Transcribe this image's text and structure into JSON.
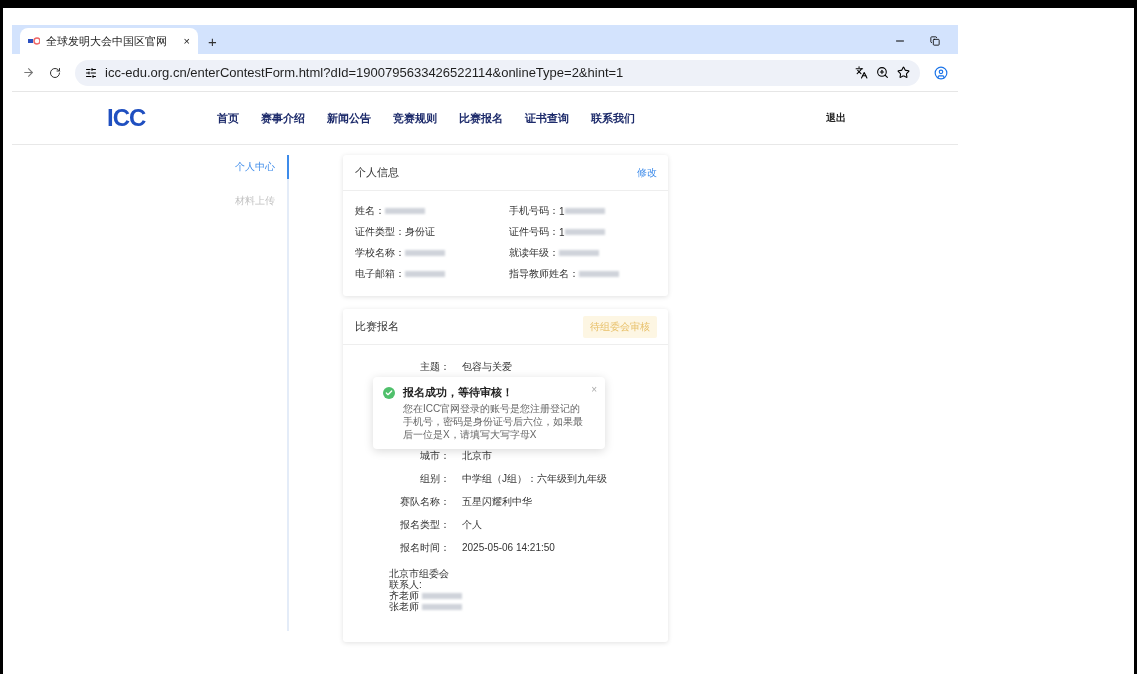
{
  "browser": {
    "tab_title": "全球发明大会中国区官网",
    "tab_close": "×",
    "new_tab": "+",
    "url": "icc-edu.org.cn/enterContestForm.html?dId=1900795633426522114&onlineType=2&hint=1"
  },
  "header": {
    "logo_big": "ICC",
    "nav": [
      {
        "label": "首页"
      },
      {
        "label": "赛事介绍"
      },
      {
        "label": "新闻公告"
      },
      {
        "label": "竞赛规则"
      },
      {
        "label": "比赛报名"
      },
      {
        "label": "证书查询"
      },
      {
        "label": "联系我们"
      }
    ],
    "logout": "退出"
  },
  "sidebar": {
    "items": [
      {
        "label": "个人中心",
        "selected": true
      },
      {
        "label": "材料上传",
        "selected": false
      }
    ]
  },
  "profile": {
    "title": "个人信息",
    "edit": "修改",
    "fields": [
      {
        "label": "姓名：",
        "blurred": true
      },
      {
        "label": "手机号码：",
        "value": "1",
        "blurred": true
      },
      {
        "label": "证件类型：",
        "value": "身份证",
        "blurred": false
      },
      {
        "label": "证件号码：",
        "value": "1",
        "blurred": true
      },
      {
        "label": "学校名称：",
        "blurred": true
      },
      {
        "label": "就读年级：",
        "blurred": true
      },
      {
        "label": "电子邮箱：",
        "blurred": true
      },
      {
        "label": "指导教师姓名：",
        "blurred": true
      }
    ]
  },
  "registration": {
    "title": "比赛报名",
    "status": "待组委会审核",
    "rows_top": [
      {
        "label": "主题：",
        "value": "包容与关爱"
      }
    ],
    "rows": [
      {
        "label": "城市：",
        "value": "北京市"
      },
      {
        "label": "组别：",
        "value": "中学组（J组）：六年级到九年级"
      },
      {
        "label": "赛队名称：",
        "value": "五星闪耀利中华"
      },
      {
        "label": "报名类型：",
        "value": "个人"
      },
      {
        "label": "报名时间：",
        "value": "2025-05-06 14:21:50"
      }
    ],
    "contact": [
      {
        "text": "北京市组委会",
        "blurred": false
      },
      {
        "text": "联系人:",
        "blurred": false
      },
      {
        "text": "齐老师",
        "blurred": true
      },
      {
        "text": "张老师",
        "blurred": true
      }
    ]
  },
  "toast": {
    "title": "报名成功，等待审核！",
    "message": "您在ICC官网登录的账号是您注册登记的手机号，密码是身份证号后六位，如果最后一位是X，请填写大写字母X",
    "close": "×"
  }
}
